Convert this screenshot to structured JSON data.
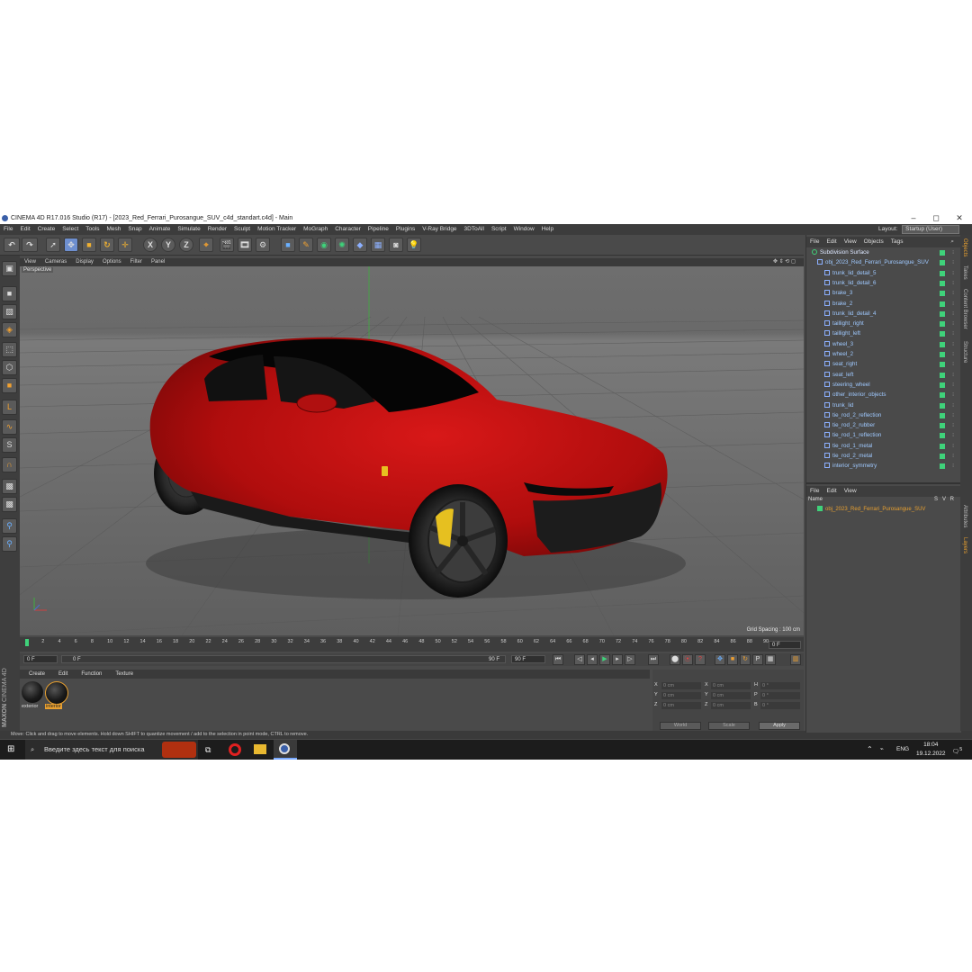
{
  "window": {
    "title": "CINEMA 4D R17.016 Studio (R17) - [2023_Red_Ferrari_Purosangue_SUV_c4d_standart.c4d] - Main",
    "controls": {
      "minimize": "–",
      "maximize": "◻",
      "close": "✕"
    }
  },
  "menubar": {
    "items": [
      "File",
      "Edit",
      "Create",
      "Select",
      "Tools",
      "Mesh",
      "Snap",
      "Animate",
      "Simulate",
      "Render",
      "Sculpt",
      "Motion Tracker",
      "MoGraph",
      "Character",
      "Pipeline",
      "Plugins",
      "V-Ray Bridge",
      "3DToAll",
      "Script",
      "Window",
      "Help"
    ],
    "layout_label": "Layout:",
    "layout_value": "Startup (User)"
  },
  "toolbar": {
    "axis_x": "X",
    "axis_y": "Y",
    "axis_z": "Z"
  },
  "viewport": {
    "menu": [
      "View",
      "Cameras",
      "Display",
      "Options",
      "Filter",
      "Panel"
    ],
    "label": "Perspective",
    "grid_spacing": "Grid Spacing : 100 cm"
  },
  "timeline": {
    "ticks": [
      "0",
      "2",
      "4",
      "6",
      "8",
      "10",
      "12",
      "14",
      "16",
      "18",
      "20",
      "22",
      "24",
      "26",
      "28",
      "30",
      "32",
      "34",
      "36",
      "38",
      "40",
      "42",
      "44",
      "46",
      "48",
      "50",
      "52",
      "54",
      "56",
      "58",
      "60",
      "62",
      "64",
      "66",
      "68",
      "70",
      "72",
      "74",
      "76",
      "78",
      "80",
      "82",
      "84",
      "86",
      "88",
      "90"
    ],
    "current_frame": "0 F",
    "start_field": "0 F",
    "range_start": "0 F",
    "range_end": "90 F",
    "end_field": "90 F"
  },
  "materials": {
    "menu": [
      "Create",
      "Edit",
      "Function",
      "Texture"
    ],
    "items": [
      {
        "label": "exterior"
      },
      {
        "label": "interior"
      }
    ]
  },
  "attributes": {
    "rows": [
      {
        "a": "X",
        "av": "0 cm",
        "b": "X",
        "bv": "0 cm",
        "c": "H",
        "cv": "0 °"
      },
      {
        "a": "Y",
        "av": "0 cm",
        "b": "Y",
        "bv": "0 cm",
        "c": "P",
        "cv": "0 °"
      },
      {
        "a": "Z",
        "av": "0 cm",
        "b": "Z",
        "bv": "0 cm",
        "c": "B",
        "cv": "0 °"
      }
    ],
    "coord_mode": "World",
    "scale_mode": "Scale",
    "apply": "Apply"
  },
  "status": {
    "text": "Move: Click and drag to move elements. Hold down SHIFT to quantize movement / add to the selection in point mode, CTRL to remove."
  },
  "object_manager": {
    "menu": [
      "File",
      "Edit",
      "View",
      "Objects",
      "Tags"
    ],
    "objects": [
      "Subdivision Surface",
      "obj_2023_Red_Ferrari_Purosangue_SUV",
      "trunk_lid_detail_5",
      "trunk_lid_detail_6",
      "brake_3",
      "brake_2",
      "trunk_lid_detail_4",
      "taillight_right",
      "taillight_left",
      "wheel_3",
      "wheel_2",
      "seat_right",
      "seat_left",
      "steering_wheel",
      "other_interior_objects",
      "trunk_lid",
      "tie_rod_2_reflection",
      "tie_rod_2_rubber",
      "tie_rod_1_reflection",
      "tie_rod_1_metal",
      "tie_rod_2_metal",
      "interior_symmetry"
    ]
  },
  "layer_manager": {
    "menu": [
      "File",
      "Edit",
      "View"
    ],
    "col_name": "Name",
    "col_s": "S",
    "col_v": "V",
    "col_r": "R",
    "item": "obj_2023_Red_Ferrari_Purosangue_SUV"
  },
  "side_tabs": [
    "Objects",
    "Takes",
    "Content Browser",
    "Structure",
    "Attributes",
    "Layers"
  ],
  "taskbar": {
    "search_placeholder": "Введите здесь текст для поиска",
    "lang": "ENG",
    "time": "18:04",
    "date": "19.12.2022",
    "notifications": "5"
  },
  "brand": {
    "maxon": "MAXON",
    "product": "CINEMA 4D"
  },
  "colors": {
    "car_body": "#c01010",
    "accent_orange": "#e8a030",
    "object_text": "#9fc9ff",
    "tag_green": "#3fd27a"
  }
}
